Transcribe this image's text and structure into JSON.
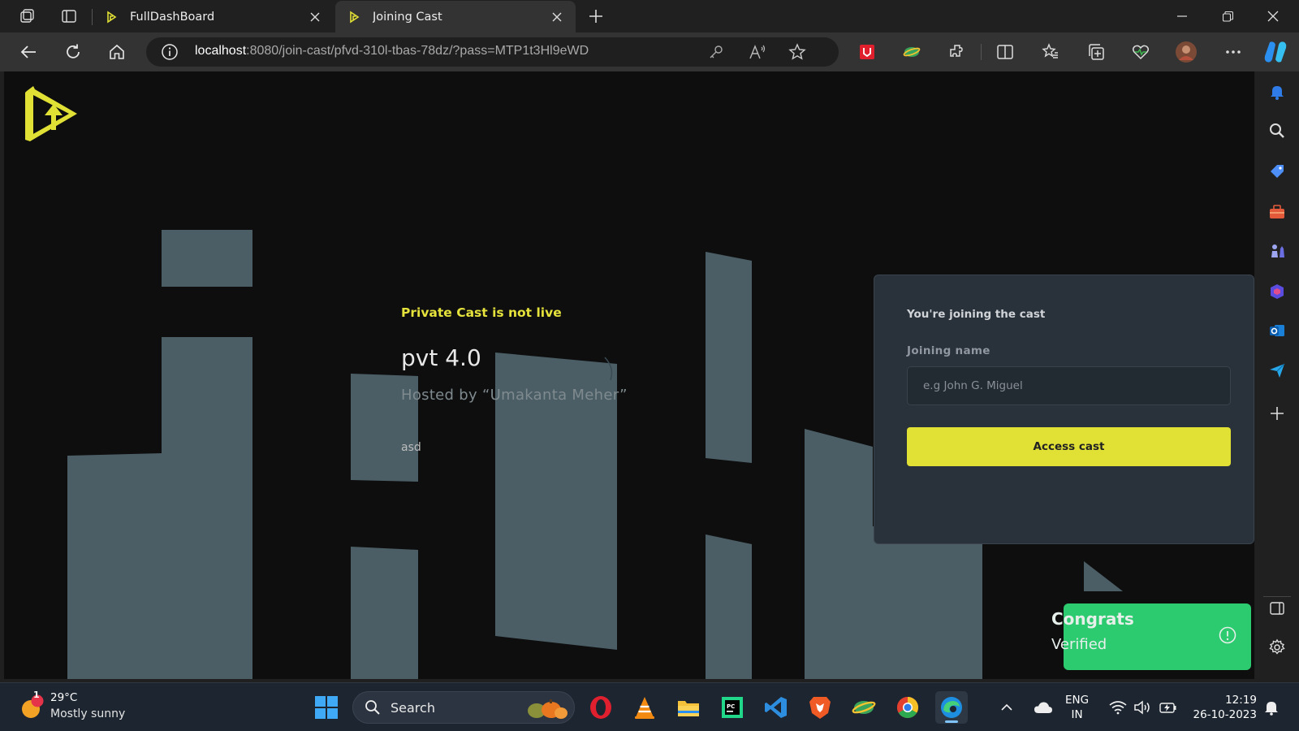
{
  "browser": {
    "tabs": [
      {
        "label": "FullDashBoard",
        "active": false
      },
      {
        "label": "Joining Cast",
        "active": true
      }
    ],
    "address": {
      "host": "localhost",
      "rest": ":8080/join-cast/pfvd-310l-tbas-78dz/?pass=MTP1t3Hl9eWD"
    }
  },
  "page": {
    "status": "Private Cast is not live",
    "title": "pvt 4.0",
    "host_line": "Hosted by “Umakanta Meher”",
    "description": "asd",
    "join_card": {
      "title": "You're joining the cast",
      "field_label": "Joining name",
      "placeholder": "e.g John G. Miguel",
      "button_label": "Access cast"
    },
    "toast": {
      "title": "Congrats",
      "message": "Verified"
    },
    "colors": {
      "accent": "#e1e035",
      "toast": "#2ccb6f",
      "card": "#29313a"
    }
  },
  "taskbar": {
    "weather": {
      "temp": "29°C",
      "condition": "Mostly sunny",
      "badge": "1"
    },
    "search_label": "Search",
    "language": {
      "line1": "ENG",
      "line2": "IN"
    },
    "clock": {
      "time": "12:19",
      "date": "26-10-2023"
    }
  }
}
